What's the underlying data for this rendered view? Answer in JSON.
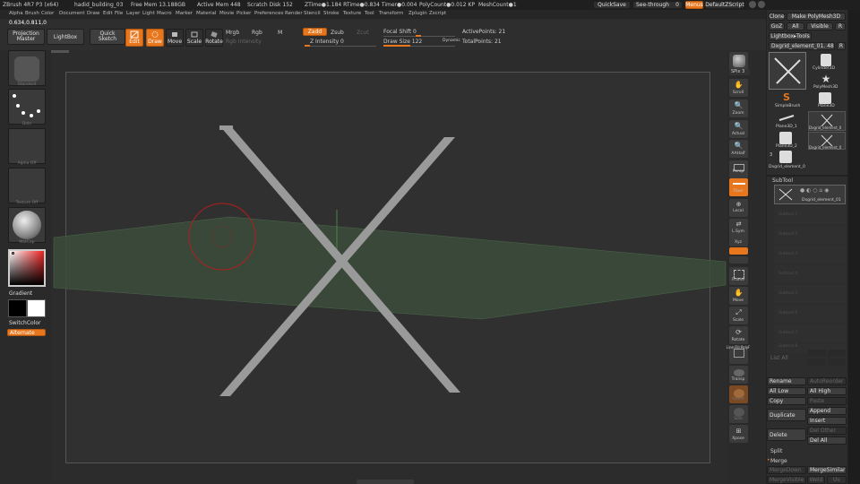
{
  "title_bar": {
    "app": "ZBrush 4R7 P3 (x64)",
    "doc": "hadid_building_03",
    "free_mem": "Free Mem 13.188GB",
    "active_mem": "Active Mem 448",
    "scratch": "Scratch Disk 152",
    "ztime": "ZTime●1.184 RTime●0.834 Timer●0.004",
    "polycount": "PolyCount●0.012 KP",
    "meshcount": "MeshCount●1",
    "quicksave": "QuickSave",
    "seethrough": "See-through",
    "seethrough_val": "0",
    "menus": "Menus",
    "defaultscript": "DefaultZScript"
  },
  "menu": [
    "Alpha",
    "Brush",
    "Color",
    "Document",
    "Draw",
    "Edit",
    "File",
    "Layer",
    "Light",
    "Macro",
    "Marker",
    "Material",
    "Movie",
    "Picker",
    "Preferences",
    "Render",
    "Stencil",
    "Stroke",
    "Texture",
    "Tool",
    "Transform",
    "Zplugin",
    "Zscript"
  ],
  "coords": "0.634,0.811,0",
  "toolbar": {
    "projection_master": "Projection Master",
    "lightbox": "LightBox",
    "quick_sketch": "Quick Sketch",
    "edit": "Edit",
    "draw": "Draw",
    "move": "Move",
    "scale": "Scale",
    "rotate": "Rotate",
    "mrgb": "Mrgb",
    "rgb": "Rgb",
    "m": "M",
    "rgb_intensity": "Rgb Intensity",
    "zadd": "Zadd",
    "zsub": "Zsub",
    "zcut": "Zcut",
    "z_intensity": "Z Intensity 0",
    "focal_shift": "Focal Shift 0",
    "draw_size": "Draw Size 122",
    "dynamic": "Dynamic",
    "active_points": "ActivePoints: 21",
    "total_points": "TotalPoints: 21"
  },
  "left_shelf": {
    "brush": "Standard",
    "stroke": "Dots",
    "alpha": "Alpha Off",
    "texture": "Texture Off",
    "material": "MatCap",
    "gradient": "Gradient",
    "switch_color": "SwitchColor",
    "alternate": "Alternate"
  },
  "right_shelf": [
    "SPix 3",
    "Scroll",
    "Zoom",
    "Actual",
    "AAHalf",
    "Persp",
    "Floor",
    "Local",
    "L.Sym",
    "Xyz",
    "",
    "",
    "Frame",
    "Move",
    "Scale",
    "Rotate",
    "Line Fill PolyF",
    "Transp",
    "Ghost",
    "Solo",
    "Xpose"
  ],
  "tool_panel": {
    "clone": "Clone",
    "make_polymesh": "Make PolyMesh3D",
    "goz": "GoZ",
    "all": "All",
    "visible": "Visible",
    "r": "R",
    "lightbox_tools": "Lightbox▸Tools",
    "current_tool": "Dxgrid_element_01. 48",
    "tool_count": "3",
    "tools": [
      "Cylinder3D",
      "PolyMesh3D",
      "SimpleBrush",
      "Plane3D",
      "Plane3D_1",
      "Dxgrid_element_0",
      "Plane3D_2",
      "Dxgrid_element_0",
      "Dxgrid_element_0"
    ],
    "subtool_header": "SubTool",
    "subtool_active": "Dxgrid_element_01",
    "subtool_slots": [
      "Subtool 1",
      "Subtool 2",
      "Subtool 3",
      "Subtool 4",
      "Subtool 5",
      "Subtool 6",
      "Subtool 7",
      "Subtool 8"
    ],
    "list_all": "List All",
    "rename": "Rename",
    "autoreorder": "AutoReorder",
    "all_low": "All Low",
    "all_high": "All High",
    "copy": "Copy",
    "paste": "Paste",
    "append": "Append",
    "duplicate": "Duplicate",
    "insert": "Insert",
    "del_other": "Del Other",
    "delete": "Delete",
    "del_all": "Del All",
    "split": "Split",
    "merge": "Merge",
    "mergedown": "MergeDown",
    "mergesimilar": "MergeSimilar",
    "mergevisible": "MergeVisible",
    "weld": "Weld",
    "uv": "Uv"
  },
  "colors": {
    "accent": "#e8761c",
    "floor_grid": "#3f5b3f",
    "x_shape": "#9a9a9a",
    "brush_circle": "#b01e1e"
  }
}
